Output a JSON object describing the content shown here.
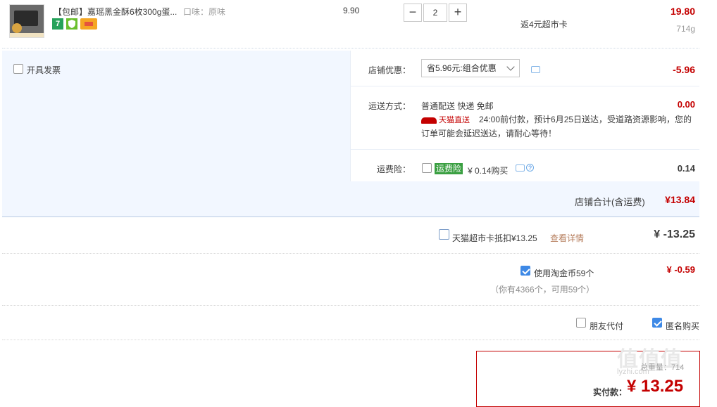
{
  "product": {
    "title": "【包邮】嘉瑶黑金酥6枚300g蛋...",
    "spec": "口味：原味",
    "unit_price": "9.90",
    "qty_minus": "−",
    "qty": "2",
    "qty_plus": "+",
    "rebate": "返4元超市卡",
    "subtotal": "19.80",
    "weight": "714g",
    "badge_seven": "7"
  },
  "shop": {
    "invoice_label": "开具发票",
    "discount_label": "店铺优惠：",
    "discount_select": "省5.96元:组合优惠",
    "discount_amount": "-5.96",
    "shipping_label": "运送方式：",
    "shipping_method": "普通配送 快递 免邮",
    "shipping_amount": "0.00",
    "tmall_direct": "天猫直送",
    "shipping_note_1": "24:00前付款，预计6月25日送达，受道路资源影响，您的",
    "shipping_note_2": "订单可能会延迟送达，请耐心等待！",
    "insurance_label": "运费险：",
    "insurance_tag": "运费险",
    "insurance_price": "¥ 0.14购买",
    "insurance_amount": "0.14",
    "question_mark": "?",
    "shop_total_label": "店铺合计(含运费)",
    "shop_total": "¥13.84"
  },
  "card": {
    "label": "天猫超市卡抵扣¥13.25",
    "details_link": "查看详情",
    "amount": "¥ -13.25"
  },
  "coins": {
    "label": "使用淘金币59个",
    "note": "（你有4366个，可用59个）",
    "amount": "¥ -0.59"
  },
  "options": {
    "friend_pay": "朋友代付",
    "anonymous": "匿名购买"
  },
  "summary": {
    "weight_text": "总重量：714",
    "paid_label": "实付款：",
    "paid_amount": "¥ 13.25"
  },
  "watermark": {
    "text": "值值值",
    "url": "lyzhi.com"
  },
  "colors": {
    "accent_red": "#c40000",
    "checkbox_blue": "#3e89e6",
    "shop_bg": "#f2f7ff",
    "insurance_green": "#3a9f41",
    "link_brown": "#b57c5b"
  }
}
